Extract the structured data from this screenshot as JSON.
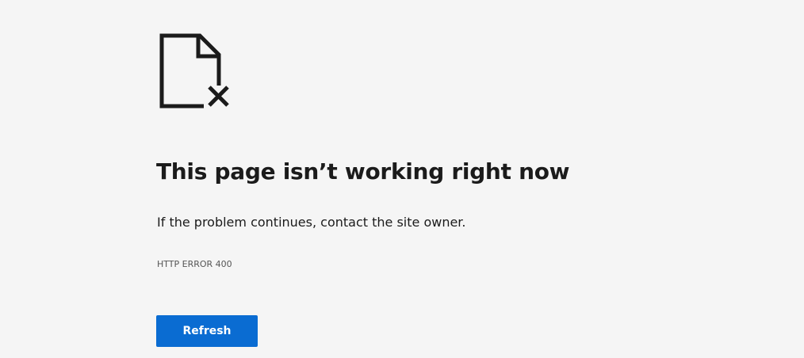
{
  "error": {
    "icon": "broken-document-icon",
    "headline": "This page isn’t working right now",
    "message": "If the problem continues, contact the site owner.",
    "code": "HTTP ERROR 400"
  },
  "actions": {
    "refresh_label": "Refresh"
  },
  "colors": {
    "background": "#f5f5f5",
    "text": "#1b1b1b",
    "secondary_text": "#555555",
    "button": "#0a6cd2",
    "button_text": "#ffffff"
  }
}
